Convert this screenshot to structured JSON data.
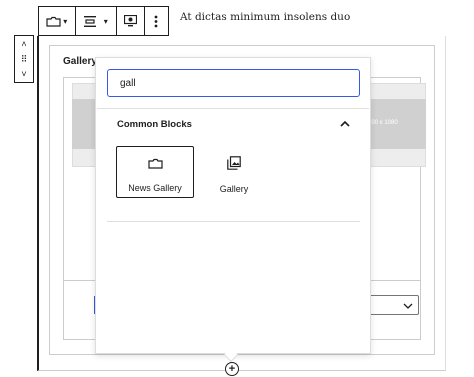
{
  "toolbar": {
    "heading_text": "At dictas minimum insolens duo",
    "icons": [
      "block-type-icon",
      "align-icon",
      "display-icon",
      "more-vertical-icon"
    ]
  },
  "mover": {
    "up": "˄",
    "drag": "⠿",
    "down": "˅"
  },
  "gallery_block": {
    "label": "Gallery",
    "placeholder_size": "600 x 1080"
  },
  "inserter": {
    "search_value": "gall",
    "section_title": "Common Blocks",
    "items": [
      {
        "label": "News Gallery",
        "icon": "folder-icon"
      },
      {
        "label": "Gallery",
        "icon": "gallery-icon"
      }
    ]
  },
  "add_block": "+",
  "colors": {
    "accent": "#3858e9",
    "text": "#1e1e1e",
    "border": "#cccccc"
  }
}
